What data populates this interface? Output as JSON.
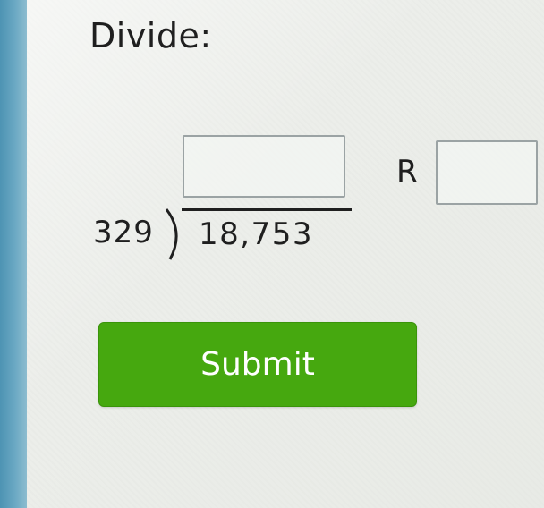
{
  "problem": {
    "prompt": "Divide:",
    "divisor": "329",
    "dividend": "18,753",
    "remainder_label": "R",
    "quotient_value": "",
    "remainder_value": ""
  },
  "actions": {
    "submit_label": "Submit"
  },
  "colors": {
    "submit_green": "#46a80f",
    "input_border": "#9ba3a4",
    "text": "#1f1f1f"
  }
}
